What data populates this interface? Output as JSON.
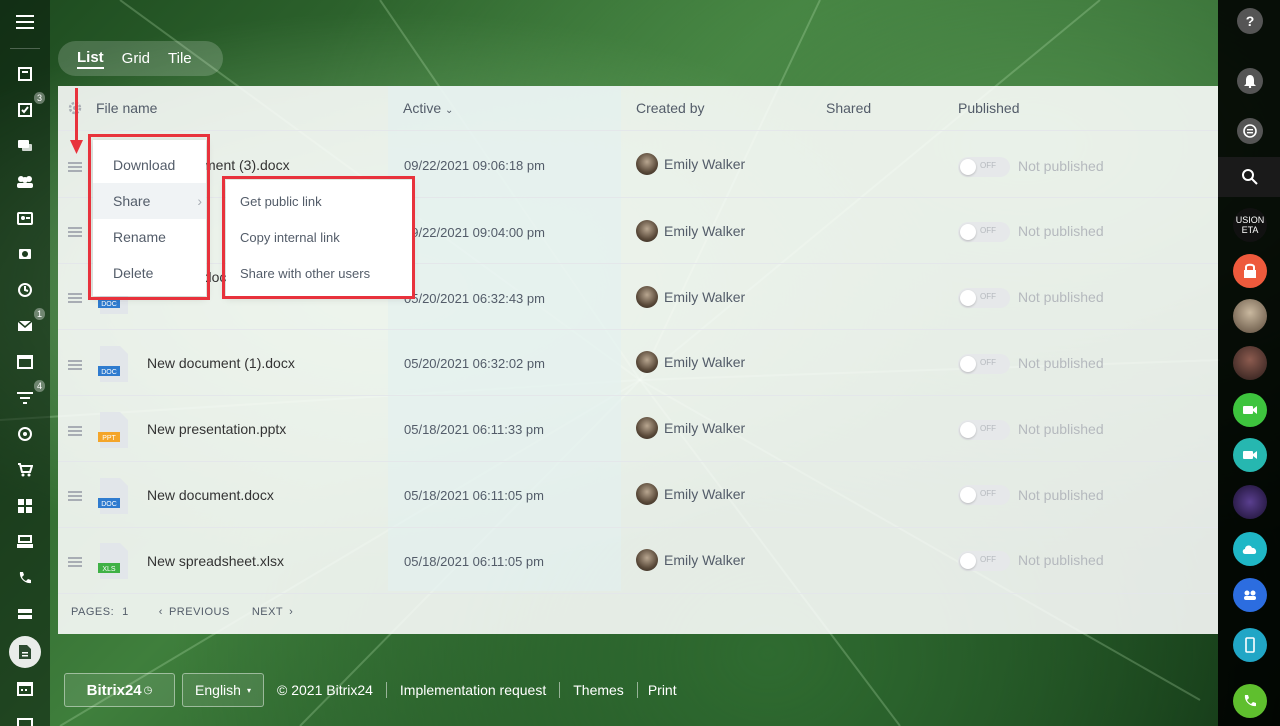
{
  "view_switch": {
    "list": "List",
    "grid": "Grid",
    "tile": "Tile"
  },
  "table": {
    "headers": {
      "file_name": "File name",
      "active": "Active",
      "created_by": "Created by",
      "shared": "Shared",
      "published": "Published"
    },
    "rows": [
      {
        "name": "ment (3).docx",
        "date": "09/22/2021 09:06:18 pm",
        "creator": "Emily Walker",
        "toggle": "OFF",
        "status": "Not published",
        "type": "DOC"
      },
      {
        "name": "",
        "date": "09/22/2021 09:04:00 pm",
        "creator": "Emily Walker",
        "toggle": "OFF",
        "status": "Not published",
        "type": "DOC"
      },
      {
        "name": "estimate.docx",
        "date": "05/20/2021 06:32:43 pm",
        "creator": "Emily Walker",
        "toggle": "OFF",
        "status": "Not published",
        "type": "DOC"
      },
      {
        "name": "New document (1).docx",
        "date": "05/20/2021 06:32:02 pm",
        "creator": "Emily Walker",
        "toggle": "OFF",
        "status": "Not published",
        "type": "DOC"
      },
      {
        "name": "New presentation.pptx",
        "date": "05/18/2021 06:11:33 pm",
        "creator": "Emily Walker",
        "toggle": "OFF",
        "status": "Not published",
        "type": "PPT"
      },
      {
        "name": "New document.docx",
        "date": "05/18/2021 06:11:05 pm",
        "creator": "Emily Walker",
        "toggle": "OFF",
        "status": "Not published",
        "type": "DOC"
      },
      {
        "name": "New spreadsheet.xlsx",
        "date": "05/18/2021 06:11:05 pm",
        "creator": "Emily Walker",
        "toggle": "OFF",
        "status": "Not published",
        "type": "XLS"
      }
    ],
    "pager": {
      "pages_label": "PAGES:",
      "page": "1",
      "previous": "PREVIOUS",
      "next": "NEXT"
    }
  },
  "context_menu": {
    "download": "Download",
    "share": "Share",
    "rename": "Rename",
    "delete": "Delete"
  },
  "share_submenu": {
    "public_link": "Get public link",
    "internal_link": "Copy internal link",
    "share_users": "Share with other users"
  },
  "left_badges": {
    "tasks": "3",
    "mail": "1",
    "filter": "4"
  },
  "footer": {
    "logo": "Bitrix24",
    "language": "English",
    "copyright": "© 2021 Bitrix24",
    "implementation": "Implementation request",
    "themes": "Themes",
    "print": "Print"
  },
  "right_bar": {
    "logo_text_top": "USION",
    "logo_text_bottom": "ETA"
  },
  "colors": {
    "highlight_red": "#e8323c",
    "doc_blue": "#2f7bcf",
    "ppt_orange": "#f4a52a",
    "xls_green": "#3fb146"
  }
}
